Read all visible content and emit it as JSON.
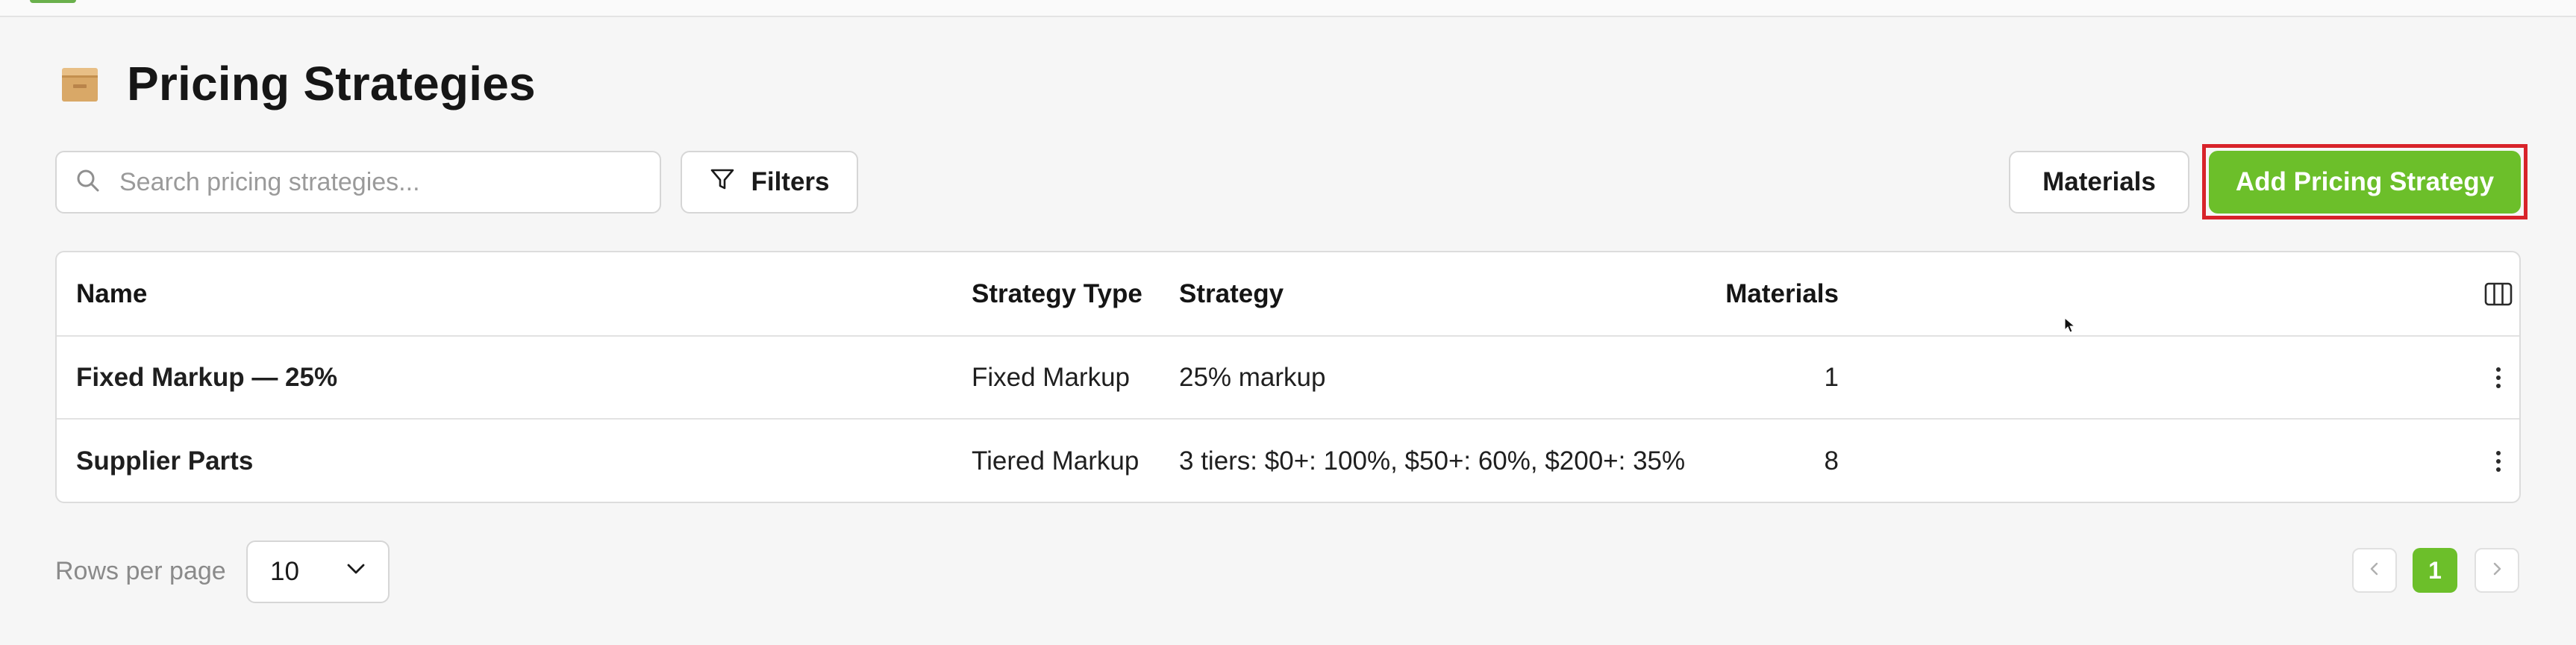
{
  "page": {
    "title": "Pricing Strategies"
  },
  "toolbar": {
    "search_placeholder": "Search pricing strategies...",
    "filters_label": "Filters",
    "materials_label": "Materials",
    "add_label": "Add Pricing Strategy"
  },
  "table": {
    "columns": [
      "Name",
      "Strategy Type",
      "Strategy",
      "Materials"
    ],
    "rows": [
      {
        "name": "Fixed Markup — 25%",
        "type": "Fixed Markup",
        "strategy": "25% markup",
        "materials": "1"
      },
      {
        "name": "Supplier Parts",
        "type": "Tiered Markup",
        "strategy": "3 tiers: $0+: 100%, $50+: 60%, $200+: 35%",
        "materials": "8"
      }
    ]
  },
  "pagination": {
    "rows_per_page_label": "Rows per page",
    "rows_per_page_value": "10",
    "current_page": "1"
  },
  "icons": {
    "header_icon": "box-icon",
    "search": "search-icon",
    "filters": "filter-icon",
    "columns": "columns-icon",
    "row_actions": "more-vertical-icon",
    "select": "chevron-down-icon",
    "prev": "chevron-left-icon",
    "next": "chevron-right-icon"
  },
  "colors": {
    "accent": "#6cbf2a",
    "highlight": "#d8232a",
    "background": "#f6f6f6"
  }
}
